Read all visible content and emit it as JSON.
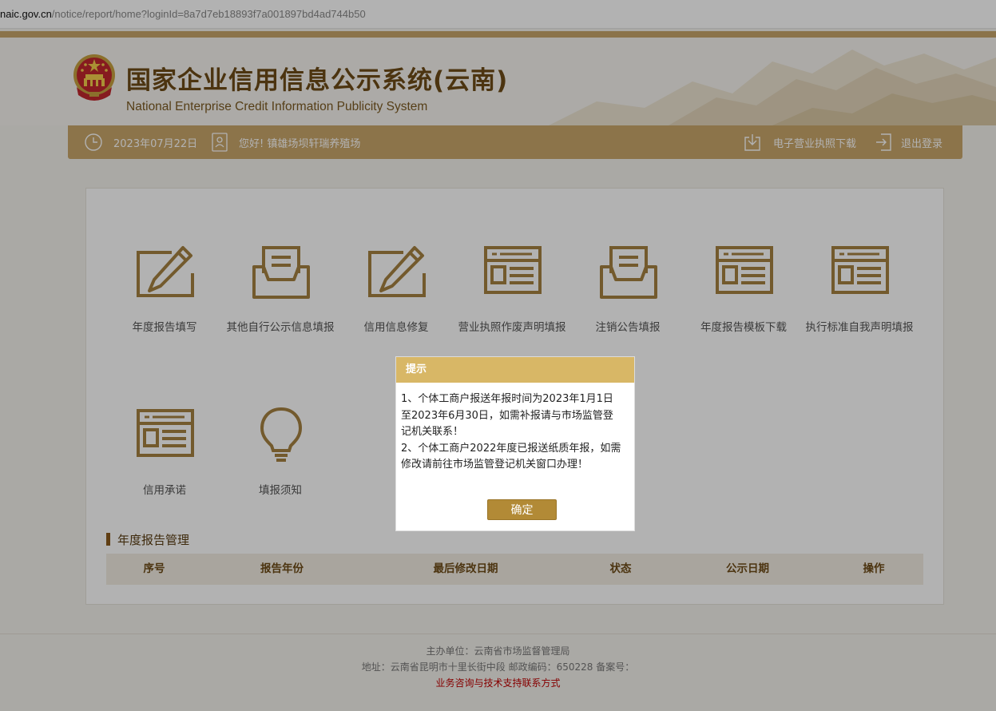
{
  "browser": {
    "url_host": "naic.gov.cn",
    "url_path": "/notice/report/home?loginId=8a7d7eb18893f7a001897bd4ad744b50"
  },
  "header": {
    "title": "国家企业信用信息公示系统(云南)",
    "subtitle": "National Enterprise Credit Information Publicity System"
  },
  "toolbar": {
    "date": "2023年07月22日",
    "greeting": "您好! 镇雄场坝轩瑞养殖场",
    "license_download": "电子营业执照下载",
    "logout": "退出登录"
  },
  "tiles": [
    {
      "label": "年度报告填写",
      "icon": "pencil-edit-icon"
    },
    {
      "label": "其他自行公示信息填报",
      "icon": "document-tray-icon"
    },
    {
      "label": "信用信息修复",
      "icon": "pencil-edit-icon"
    },
    {
      "label": "营业执照作废声明填报",
      "icon": "browser-form-icon"
    },
    {
      "label": "注销公告填报",
      "icon": "document-tray-icon"
    },
    {
      "label": "年度报告模板下载",
      "icon": "browser-form-icon"
    },
    {
      "label": "执行标准自我声明填报",
      "icon": "browser-form-icon"
    },
    {
      "label": "信用承诺",
      "icon": "browser-form-icon"
    },
    {
      "label": "填报须知",
      "icon": "lightbulb-icon"
    }
  ],
  "annual_report": {
    "title": "年度报告管理",
    "columns": [
      "序号",
      "报告年份",
      "最后修改日期",
      "状态",
      "公示日期",
      "操作"
    ]
  },
  "footer": {
    "organizer": "主办单位：云南省市场监督管理局",
    "address": "地址：云南省昆明市十里长街中段 邮政编码：650228 备案号：",
    "contact_link": "业务咨询与技术支持联系方式"
  },
  "dialog": {
    "title": "提示",
    "lines": [
      "1、个体工商户报送年报时间为2023年1月1日",
      "至2023年6月30日，如需补报请与市场监管登",
      "记机关联系！",
      "2、个体工商户2022年度已报送纸质年报，如需",
      "修改请前往市场监管登记机关窗口办理！"
    ],
    "confirm": "确定"
  },
  "colors": {
    "gold": "#c9a66b",
    "icon_brown": "#a58141",
    "dialog_header": "#d8b766",
    "confirm_button": "#b28a36",
    "footer_link": "#c00000"
  }
}
